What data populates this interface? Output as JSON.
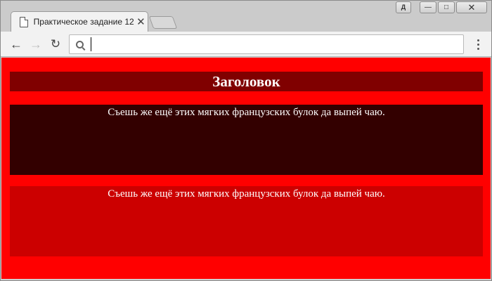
{
  "browser": {
    "tab_title": "Практическое задание 12",
    "tab_close": "✕",
    "user_button": "Д",
    "minimize": "—",
    "maximize": "□",
    "close": "✕",
    "back": "←",
    "forward": "→",
    "reload": "↻",
    "url": "",
    "url_placeholder": ""
  },
  "page": {
    "heading": "Заголовок",
    "blocks": [
      {
        "text": "Съешь же ещё этих мягких французских булок да выпей чаю."
      },
      {
        "text": "Съешь же ещё этих мягких французских булок да выпей чаю."
      }
    ]
  },
  "colors": {
    "page_background": "#ff0000",
    "heading_background": "#800000",
    "block_1_background": "#330000",
    "block_2_background": "#cc0000",
    "text": "#ffffff"
  }
}
